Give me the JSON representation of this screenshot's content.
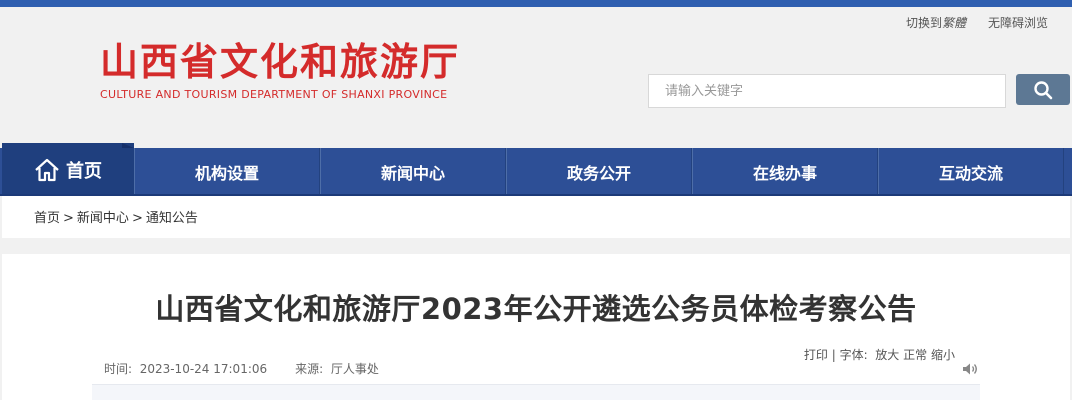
{
  "util": {
    "switch_prefix": "切换到",
    "switch_traditional": "繁體",
    "accessible": "无障碍浏览"
  },
  "logo": {
    "cn": "山西省文化和旅游厅",
    "en": "CULTURE AND TOURISM DEPARTMENT OF SHANXI PROVINCE"
  },
  "search": {
    "placeholder": "请输入关键字",
    "value": ""
  },
  "nav": {
    "home": "首页",
    "items": [
      "机构设置",
      "新闻中心",
      "政务公开",
      "在线办事",
      "互动交流"
    ]
  },
  "breadcrumb": [
    "首页",
    "新闻中心",
    "通知公告"
  ],
  "breadcrumb_sep": ">",
  "article": {
    "title": "山西省文化和旅游厅2023年公开遴选公务员体检考察公告",
    "time_label": "时间:",
    "time": "2023-10-24 17:01:06",
    "source_label": "来源:",
    "source": "厅人事处"
  },
  "tools": {
    "print": "打印",
    "divider": "|",
    "font_label": "字体:",
    "large": "放大",
    "normal": "正常",
    "small": "缩小"
  },
  "colors": {
    "top_bar": "#2f5fb0",
    "nav": "#2d4f96",
    "nav_home": "#1f3f7e",
    "logo_red": "#d42b2b",
    "search_button": "#5d7894"
  },
  "icons": {
    "home": "home-icon",
    "search": "search-icon",
    "speaker": "speaker-icon"
  }
}
